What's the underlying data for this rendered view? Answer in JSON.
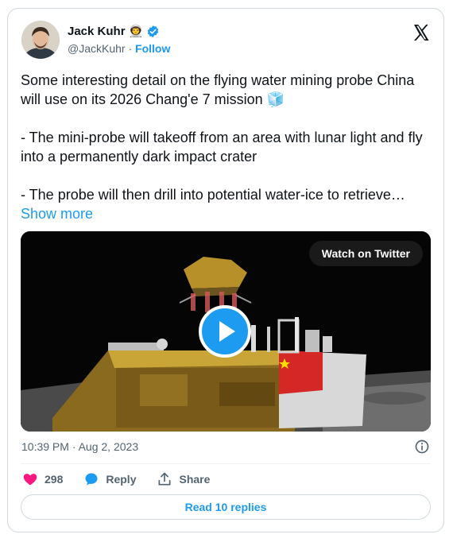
{
  "author": {
    "name": "Jack Kuhr",
    "name_emoji": "👨‍🚀",
    "handle": "@JackKuhr",
    "separator": "·",
    "follow_label": "Follow"
  },
  "tweet": {
    "text": "Some interesting detail on the flying water mining probe China will use on its 2026 Chang'e 7 mission 🧊\n\n- The mini-probe will takeoff from an area with lunar light and fly into a permanently dark impact crater\n\n- The probe will then drill into potential water-ice to retrieve…",
    "show_more_label": "Show more"
  },
  "media": {
    "watch_label": "Watch on Twitter"
  },
  "meta": {
    "timestamp": "10:39 PM · Aug 2, 2023"
  },
  "actions": {
    "likes_count": "298",
    "reply_label": "Reply",
    "share_label": "Share"
  },
  "replies_button_label": "Read 10 replies",
  "colors": {
    "accent": "#1d9bf0",
    "like": "#f91880",
    "muted": "#536471",
    "border": "#cfd9de"
  },
  "icons": [
    "x-logo-icon",
    "verified-badge-icon",
    "heart-icon",
    "reply-bubble-icon",
    "share-icon",
    "info-icon",
    "play-icon"
  ]
}
